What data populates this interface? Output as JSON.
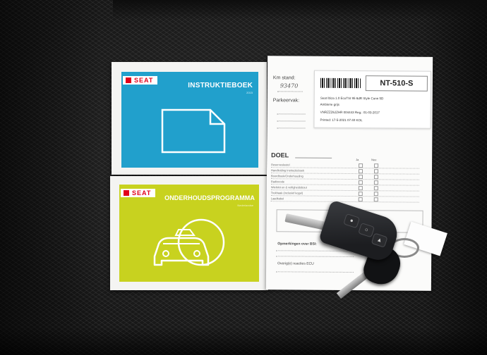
{
  "scene": {
    "instruction_booklet": {
      "brand": "SEAT",
      "title": "INSTRUKTIEBOEK",
      "subtitle": "2015",
      "cover_color": "#21a0cc",
      "icon": "document-icon"
    },
    "maintenance_booklet": {
      "brand": "SEAT",
      "title": "ONDERHOUDSPROGRAMMA",
      "subtitle": "Nederlandse",
      "cover_color": "#c8d21f",
      "icon": "car-service-icon"
    },
    "service_form": {
      "km_label": "Km stand:",
      "km_value": "93470",
      "parking_label": "Parkeervak:",
      "plate": "NT-510-S",
      "sticker_lines": [
        "Seat Ibiza 1.0 EcoTSI 95 6dR Style Conn 5D",
        "Ambiene grijs",
        "VNRZZZ6JZHR 004443          Reg.: 01-03-2017",
        "Printed: 17-5-2021 07:40                        KOL"
      ],
      "doel_label": "DOEL",
      "col_yes": "Ja",
      "col_no": "Nee",
      "rows": [
        "Reservesleutel",
        "Handleiding Instructieboek",
        "Boordboek/Onderhouding",
        "Radiocode",
        "Wielslot en & veiligheidsbout",
        "Trekhaak (inclusief kogel)",
        "Laadkabel"
      ],
      "remarks_label": "Opmerkingen over BSI:",
      "remarks_label2": "Overig(e) reacties ECU"
    },
    "key": {
      "type": "flip key fob",
      "buttons": [
        "lock",
        "unlock",
        "trunk"
      ]
    },
    "colors": {
      "seat_fabric": "#1d1d1d",
      "paper": "#fbfbfa",
      "seat_brand_red": "#e2001a"
    }
  }
}
